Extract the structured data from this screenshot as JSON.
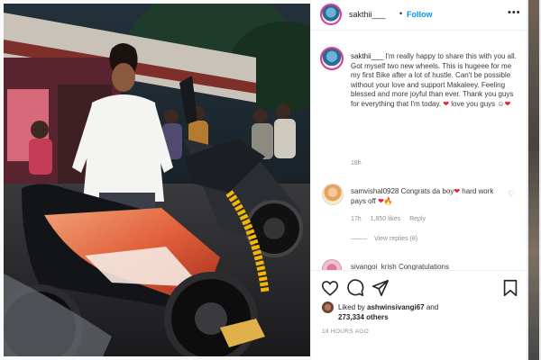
{
  "post": {
    "username": "sakthii___",
    "dot": "•",
    "follow_label": "Follow",
    "more_label": "•••",
    "caption_user": "sakthii___",
    "caption_text": "I'm really happy to share this with you all. Got myself two new wheels. This is hugeee for me my first Bike after a lot of hustle. Can't be possible without your love and support Makaleey. Feeling blessed and more joyful than ever. Thank you guys for everything that I'm today.",
    "caption_end": "love you guys",
    "caption_time": "18h"
  },
  "comments": [
    {
      "user": "samvishal0928",
      "text_a": "Congrats da boy",
      "text_b": "hard work pays off",
      "time": "17h",
      "likes": "1,850 likes",
      "reply": "Reply",
      "view_replies": "View replies (8)"
    },
    {
      "user": "sivangoi_krish",
      "text": "Congratulations"
    }
  ],
  "actions": {
    "liked_prefix": "Liked by ",
    "liked_user": "ashwinsivangi67",
    "liked_and": " and",
    "liked_count": "273,334 others",
    "post_time": "18 HOURS AGO"
  },
  "icons": {
    "like": "heart-outline-icon",
    "comment": "speech-bubble-icon",
    "share": "paper-plane-icon",
    "save": "bookmark-icon",
    "more": "ellipsis-icon"
  },
  "colors": {
    "follow": "#0095f6",
    "heart": "#ed1c3c",
    "story_ring": "#d93d8c"
  }
}
